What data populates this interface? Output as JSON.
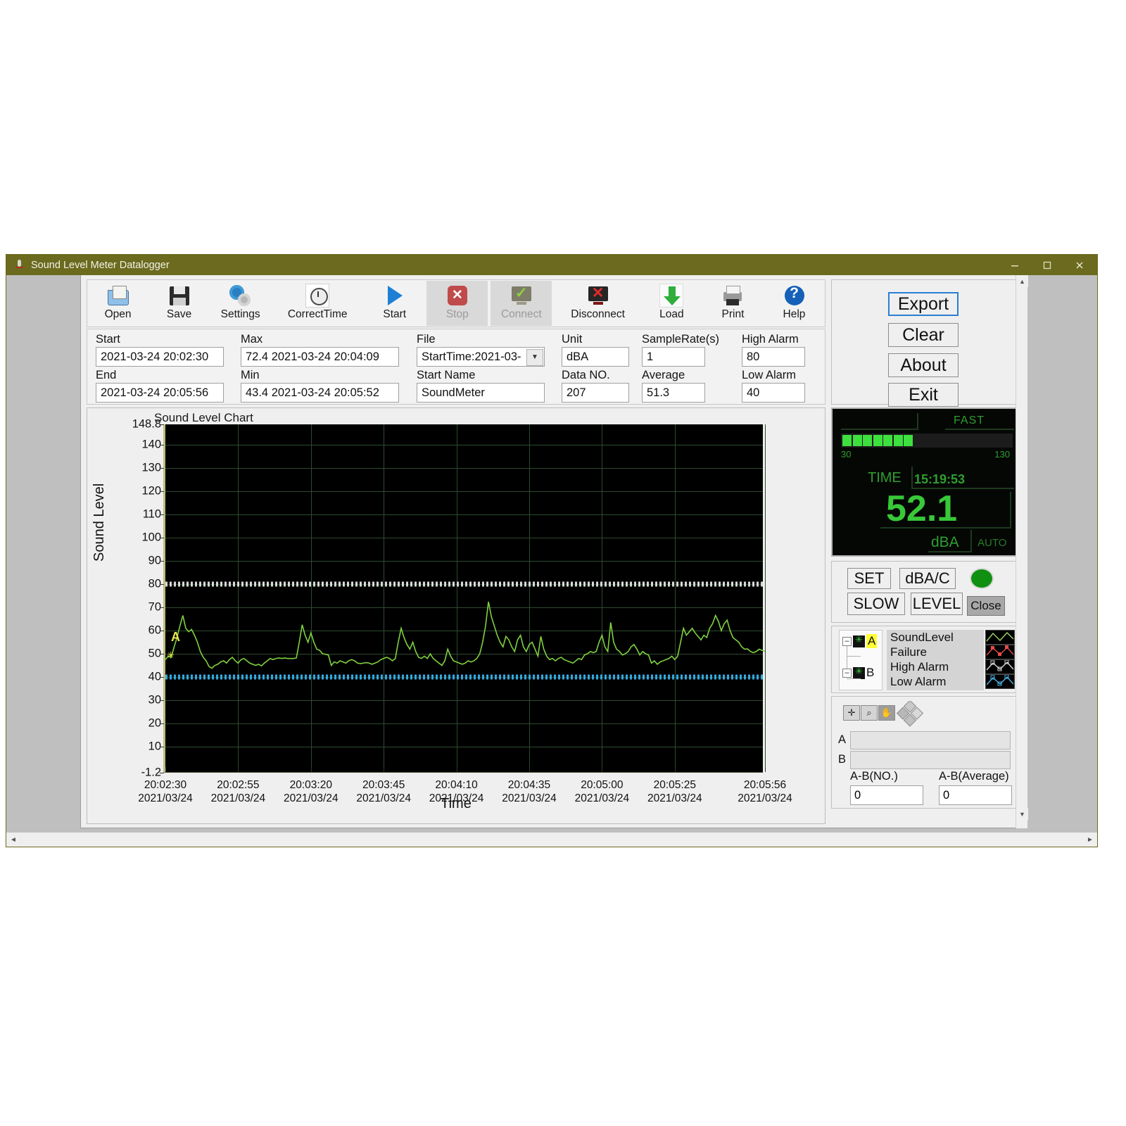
{
  "window": {
    "title": "Sound Level Meter Datalogger",
    "icon": "microphone-icon",
    "minimize": "minimize-icon",
    "maximize": "maximize-icon",
    "close": "close-icon"
  },
  "toolbar": {
    "items": [
      {
        "label": "Open",
        "icon": "open-folder-icon",
        "disabled": false
      },
      {
        "label": "Save",
        "icon": "floppy-disk-icon",
        "disabled": false
      },
      {
        "label": "Settings",
        "icon": "gear-icon",
        "disabled": false
      },
      {
        "label": "CorrectTime",
        "icon": "clock-icon",
        "disabled": false
      },
      {
        "label": "Start",
        "icon": "play-icon",
        "disabled": false
      },
      {
        "label": "Stop",
        "icon": "stop-icon",
        "disabled": true
      },
      {
        "label": "Connect",
        "icon": "connect-icon",
        "disabled": true
      },
      {
        "label": "Disconnect",
        "icon": "disconnect-icon",
        "disabled": false
      },
      {
        "label": "Load",
        "icon": "download-arrow-icon",
        "disabled": false
      },
      {
        "label": "Print",
        "icon": "printer-icon",
        "disabled": false
      },
      {
        "label": "Help",
        "icon": "help-question-icon",
        "disabled": false
      }
    ]
  },
  "fields": {
    "start_label": "Start",
    "start_value": "2021-03-24 20:02:30",
    "end_label": "End",
    "end_value": "2021-03-24  20:05:56",
    "max_label": "Max",
    "max_value": "72.4 2021-03-24  20:04:09",
    "min_label": "Min",
    "min_value": "43.4 2021-03-24  20:05:52",
    "file_label": "File",
    "file_value": "StartTime:2021-03-",
    "startname_label": "Start Name",
    "startname_value": "SoundMeter",
    "unit_label": "Unit",
    "unit_value": "dBA",
    "datano_label": "Data NO.",
    "datano_value": "207",
    "samplerate_label": "SampleRate(s)",
    "samplerate_value": "1",
    "average_label": "Average",
    "average_value": "51.3",
    "highalarm_label": "High Alarm",
    "highalarm_value": "80",
    "lowalarm_label": "Low Alarm",
    "lowalarm_value": "40"
  },
  "sidebuttons": {
    "export": "Export",
    "clear": "Clear",
    "about": "About",
    "exit": "Exit"
  },
  "lcd": {
    "mode": "FAST",
    "scale_min": "30",
    "scale_max": "130",
    "time_label": "TIME",
    "time_value": "15:19:53",
    "reading": "52.1",
    "unit": "dBA",
    "range": "AUTO",
    "bar_segments": 7,
    "color_green": "#3ee03e"
  },
  "lcd_buttons": {
    "set": "SET",
    "dbac": "dBA/C",
    "slow": "SLOW",
    "level": "LEVEL",
    "close": "Close",
    "led": "green-led-indicator"
  },
  "legend": {
    "tree_a": "A",
    "tree_b": "B",
    "rows": [
      {
        "label": "SoundLevel",
        "color": "#9fd96a"
      },
      {
        "label": "Failure",
        "color": "#e84a4a"
      },
      {
        "label": "High Alarm",
        "color": "#d8d8d8"
      },
      {
        "label": "Low Alarm",
        "color": "#4ab4e8"
      }
    ]
  },
  "cursor_panel": {
    "tools": [
      "crosshair-icon",
      "zoom-icon",
      "pan-hand-icon"
    ],
    "palette": "diamond-palette-icon",
    "a_label": "A",
    "a_value": "",
    "b_label": "B",
    "b_value": "",
    "ab_no_label": "A-B(NO.)",
    "ab_no_value": "0",
    "ab_avg_label": "A-B(Average)",
    "ab_avg_value": "0"
  },
  "chart_data": {
    "type": "line",
    "title": "Sound Level Chart",
    "xlabel": "Time",
    "ylabel": "Sound Level",
    "ylim": [
      -1.2,
      148.8
    ],
    "yticks": [
      148.8,
      140,
      130,
      120,
      110,
      100,
      90,
      80,
      70,
      60,
      50,
      40,
      30,
      20,
      10,
      -1.2
    ],
    "ytick_labels": [
      "148.8",
      "140",
      "130",
      "120",
      "110",
      "100",
      "90",
      "80",
      "70",
      "60",
      "50",
      "40",
      "30",
      "20",
      "10",
      "-1.2"
    ],
    "xticks": [
      0,
      25,
      50,
      75,
      100,
      125,
      150,
      175,
      206
    ],
    "xtick_labels": [
      "20:02:30\n2021/03/24",
      "20:02:55\n2021/03/24",
      "20:03:20\n2021/03/24",
      "20:03:45\n2021/03/24",
      "20:04:10\n2021/03/24",
      "20:04:35\n2021/03/24",
      "20:05:00\n2021/03/24",
      "20:05:25\n2021/03/24",
      "20:05:56\n2021/03/24"
    ],
    "grid": true,
    "legend_position": "right-panel",
    "background": "#000000",
    "series": [
      {
        "name": "SoundLevel",
        "color": "#7fd13f",
        "unit": "dBA",
        "values": [
          47.5,
          49.0,
          48.5,
          53.0,
          57.0,
          62.0,
          66.5,
          61.0,
          59.5,
          60.5,
          58.0,
          55.0,
          51.0,
          48.5,
          47.0,
          44.5,
          43.8,
          45.0,
          45.5,
          46.5,
          47.0,
          46.0,
          47.5,
          48.5,
          47.0,
          46.0,
          47.5,
          48.0,
          47.0,
          46.0,
          45.5,
          45.0,
          45.5,
          44.8,
          46.0,
          47.0,
          48.0,
          47.5,
          48.0,
          48.2,
          48.0,
          48.2,
          48.0,
          48.0,
          48.0,
          48.2,
          55.0,
          62.5,
          58.0,
          55.0,
          59.0,
          55.0,
          52.0,
          51.5,
          50.0,
          49.8,
          49.5,
          45.0,
          46.5,
          46.0,
          47.0,
          46.5,
          46.0,
          47.0,
          47.5,
          47.0,
          46.0,
          45.8,
          46.0,
          46.2,
          46.0,
          45.5,
          46.0,
          46.5,
          47.5,
          48.0,
          48.5,
          48.0,
          47.0,
          48.0,
          55.0,
          61.0,
          57.0,
          54.0,
          52.0,
          55.0,
          51.0,
          48.5,
          48.0,
          49.0,
          48.0,
          50.0,
          48.0,
          47.0,
          46.0,
          45.0,
          47.0,
          52.0,
          49.0,
          47.0,
          46.5,
          46.0,
          45.5,
          46.0,
          47.0,
          46.5,
          47.0,
          48.0,
          50.0,
          55.0,
          62.0,
          72.4,
          66.0,
          62.0,
          58.0,
          55.0,
          53.0,
          57.5,
          56.0,
          53.0,
          51.0,
          56.0,
          58.0,
          53.0,
          51.0,
          54.0,
          55.0,
          52.0,
          49.0,
          57.5,
          52.0,
          49.0,
          47.5,
          48.0,
          47.0,
          48.0,
          48.5,
          47.5,
          47.0,
          46.5,
          46.0,
          47.0,
          48.0,
          47.5,
          49.5,
          50.0,
          51.0,
          50.5,
          51.0,
          55.0,
          58.0,
          53.0,
          51.0,
          63.5,
          55.0,
          52.0,
          51.0,
          49.5,
          50.0,
          51.0,
          53.0,
          54.0,
          52.0,
          49.5,
          51.0,
          50.0,
          49.5,
          46.0,
          47.0,
          45.5,
          46.5,
          47.0,
          47.5,
          48.0,
          49.0,
          47.5,
          49.0,
          55.0,
          61.0,
          58.0,
          59.5,
          61.0,
          59.0,
          57.5,
          56.0,
          58.0,
          57.0,
          61.0,
          63.0,
          66.5,
          64.0,
          60.0,
          63.0,
          64.5,
          60.0,
          57.0,
          56.0,
          55.0,
          53.0,
          52.0,
          52.1,
          51.0,
          50.5,
          51.0,
          52.0,
          51.5,
          51.0
        ]
      },
      {
        "name": "High Alarm",
        "color": "#d8d8d8",
        "constant": 80
      },
      {
        "name": "Low Alarm",
        "color": "#33a8e0",
        "constant": 40
      }
    ]
  }
}
